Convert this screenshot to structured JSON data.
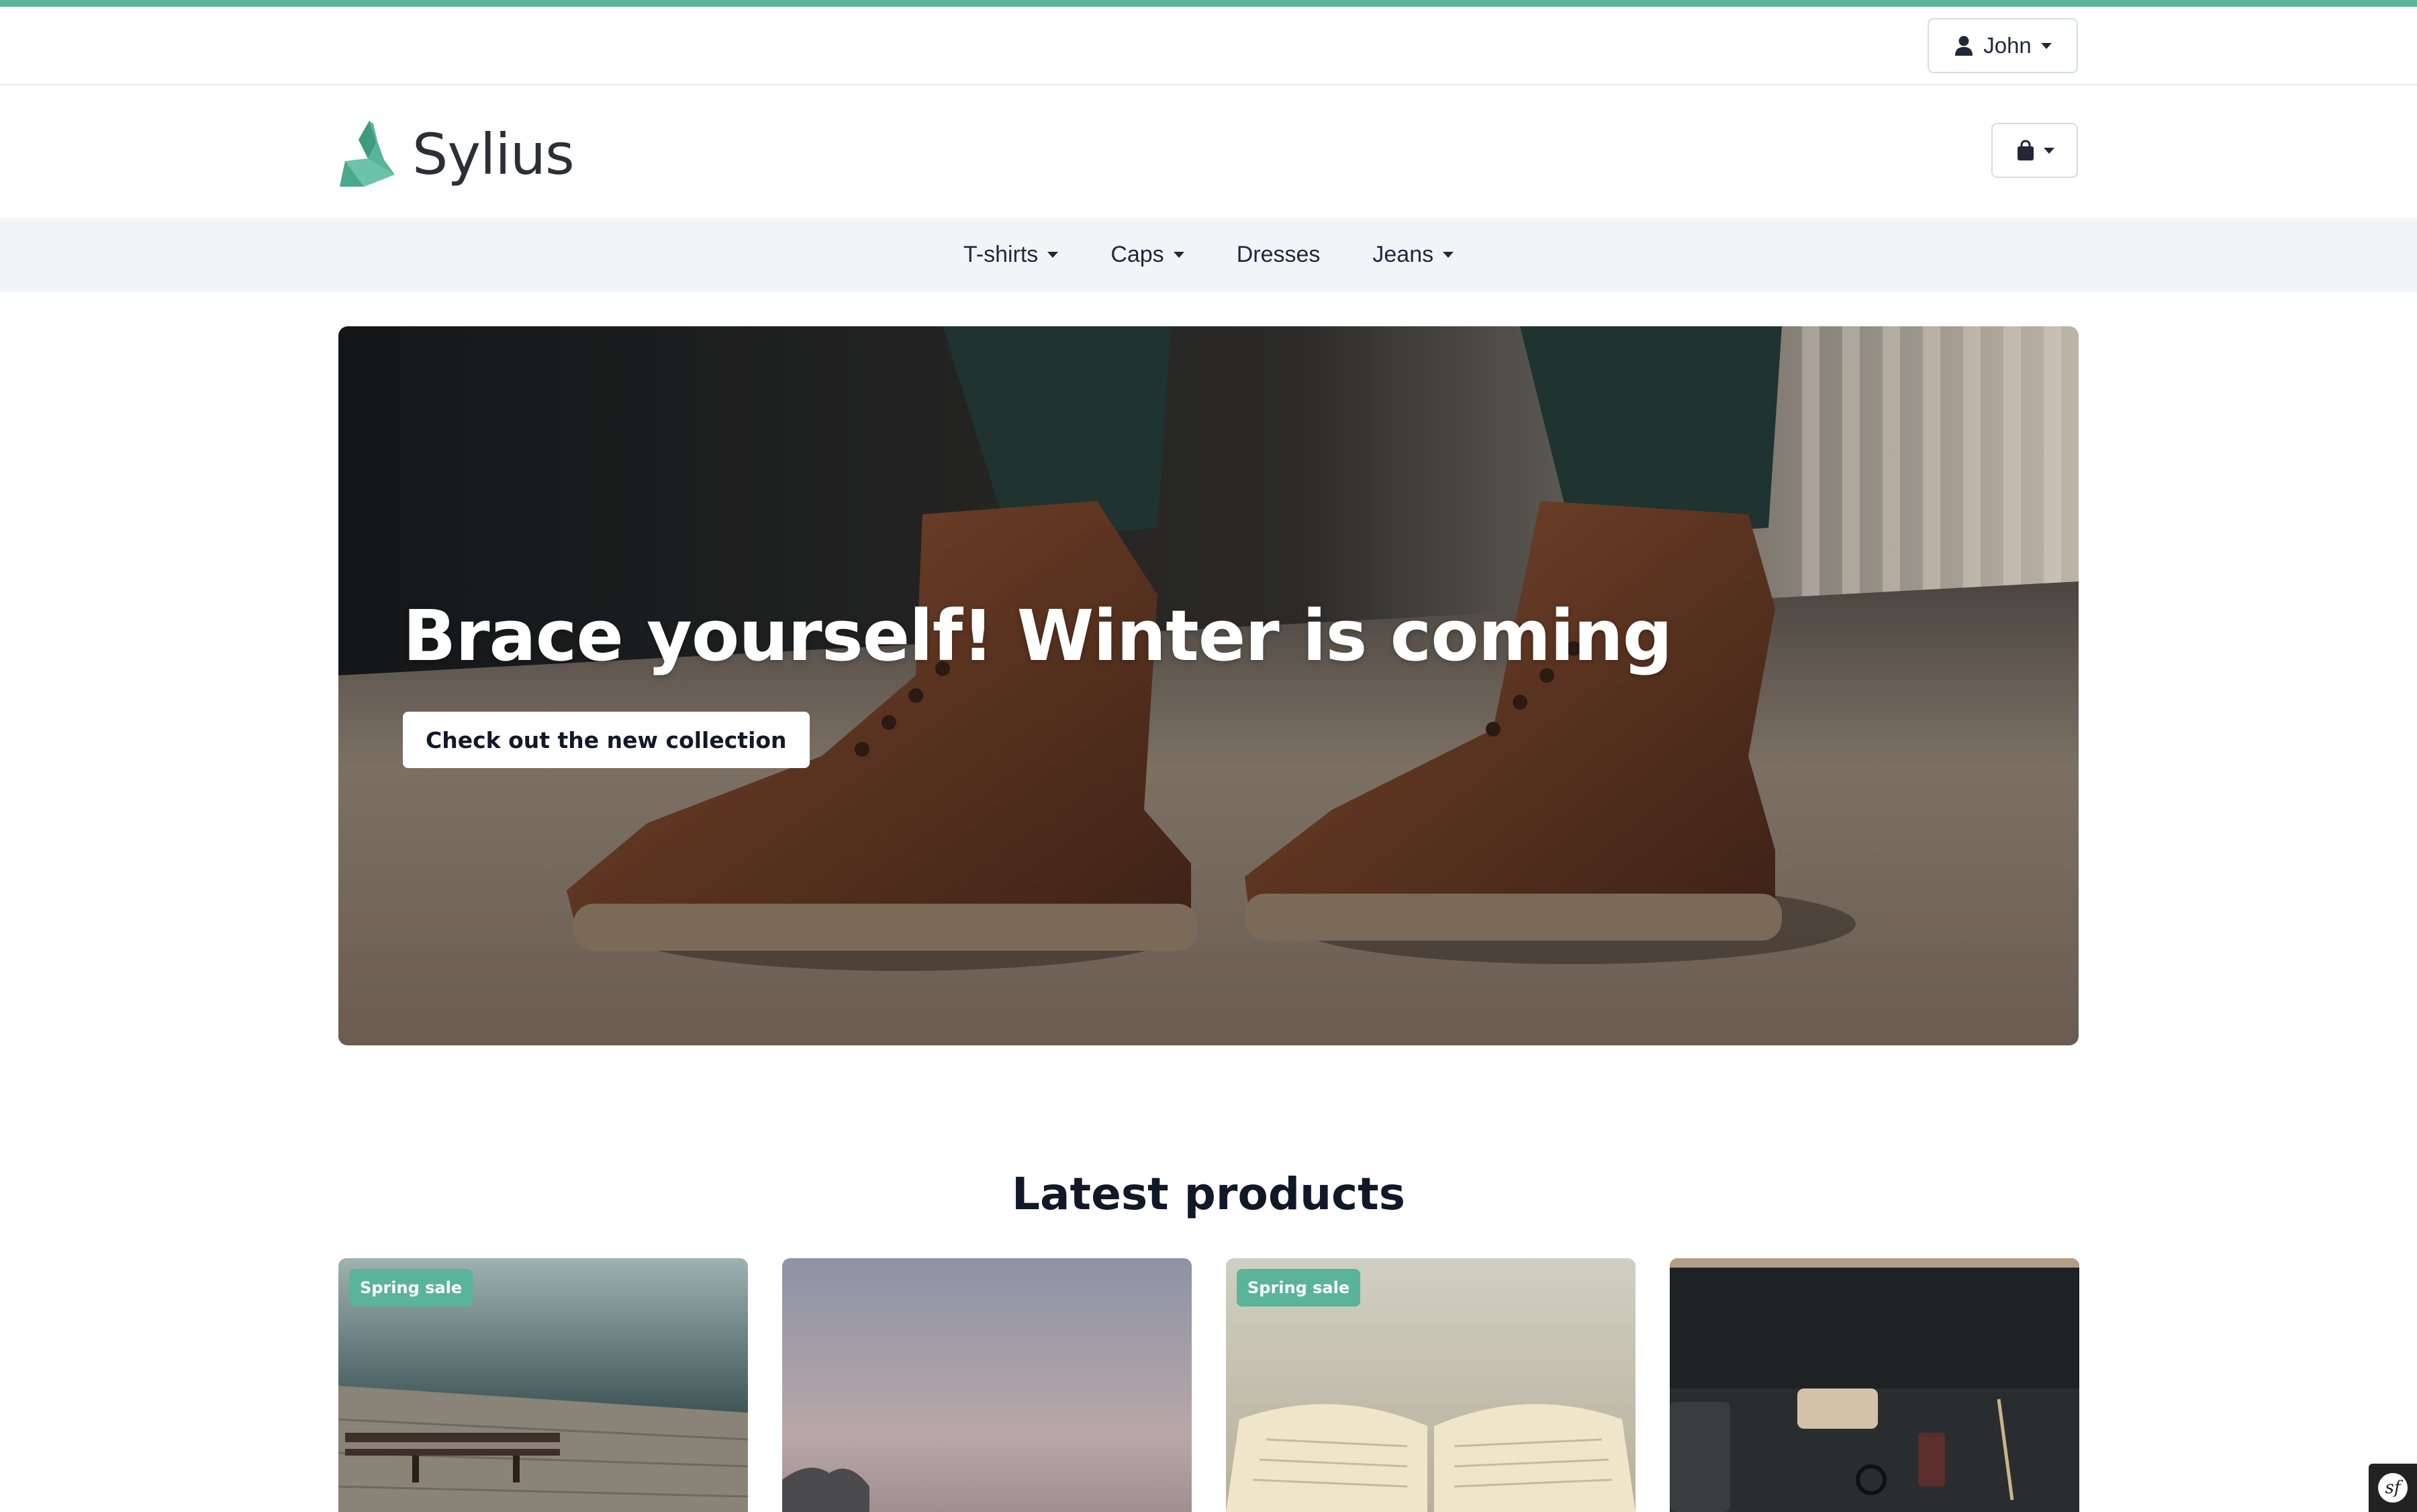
{
  "colors": {
    "accent": "#5ab49a",
    "nav_bg": "#f2f5f8",
    "text": "#1f2937"
  },
  "user_menu": {
    "label": "John",
    "icon": "user-icon"
  },
  "logo": {
    "text": "Sylius"
  },
  "cart": {
    "icon": "shopping-bag-icon"
  },
  "nav": {
    "items": [
      {
        "label": "T-shirts",
        "has_dropdown": true
      },
      {
        "label": "Caps",
        "has_dropdown": true
      },
      {
        "label": "Dresses",
        "has_dropdown": false
      },
      {
        "label": "Jeans",
        "has_dropdown": true
      }
    ]
  },
  "hero": {
    "title": "Brace yourself! Winter is coming",
    "cta_label": "Check out the new collection"
  },
  "latest": {
    "title": "Latest products",
    "products": [
      {
        "badge": "Spring sale"
      },
      {
        "badge": ""
      },
      {
        "badge": "Spring sale"
      },
      {
        "badge": ""
      }
    ]
  }
}
